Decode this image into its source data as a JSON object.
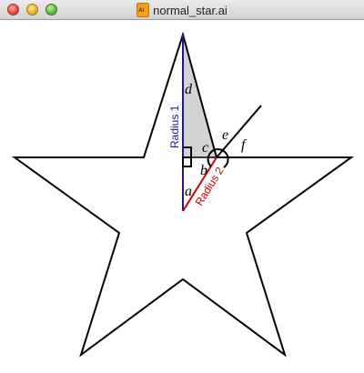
{
  "window": {
    "title": "normal_star.ai"
  },
  "diagram": {
    "radius1_label": "Radius 1",
    "radius2_label": "Radius 2",
    "labels": {
      "a": "a",
      "b": "b",
      "c": "c",
      "d": "d",
      "e": "e",
      "f": "f"
    },
    "colors": {
      "radius1": "#1a1a8c",
      "radius2": "#cc0000",
      "outline": "#000000",
      "shade": "#d3d3d3"
    }
  }
}
